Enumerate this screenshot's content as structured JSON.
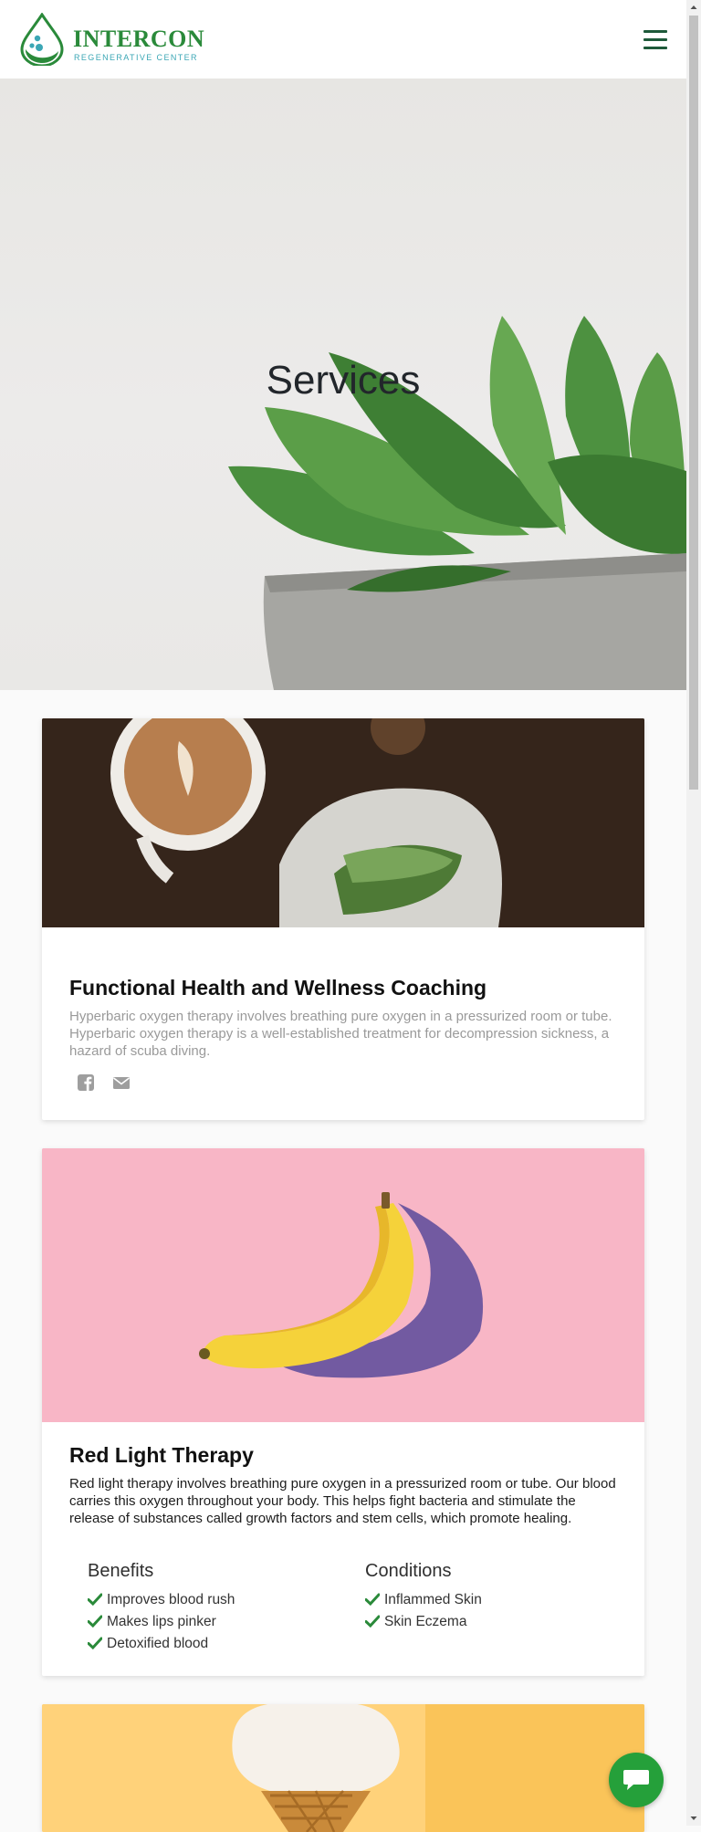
{
  "header": {
    "brand_name": "INTERCON",
    "brand_sub": "REGENERATIVE CENTER",
    "menu_icon": "hamburger-icon",
    "brand_color": "#2a8a3a",
    "accent_color": "#3ba7b5"
  },
  "hero": {
    "title": "Services"
  },
  "cards": [
    {
      "title": "Functional Health and Wellness Coaching",
      "text": "Hyperbaric oxygen therapy involves breathing pure oxygen in a pressurized room or tube. Hyperbaric oxygen therapy is a well-established treatment for decompression sickness, a hazard of scuba diving.",
      "share_icons": [
        "facebook-icon",
        "mail-icon"
      ]
    },
    {
      "title": "Red Light Therapy",
      "text": "Red light therapy involves breathing pure oxygen in a pressurized room or tube. Our blood carries this oxygen throughout your body. This helps fight bacteria and stimulate the release of substances called growth factors and stem cells, which promote healing.",
      "benefits_heading": "Benefits",
      "benefits": [
        "Improves blood rush",
        "Makes lips pinker",
        "Detoxified blood"
      ],
      "conditions_heading": "Conditions",
      "conditions": [
        "Inflammed Skin",
        "Skin Eczema"
      ]
    }
  ],
  "chat": {
    "icon": "chat-bubble-icon",
    "color": "#25a03a"
  }
}
